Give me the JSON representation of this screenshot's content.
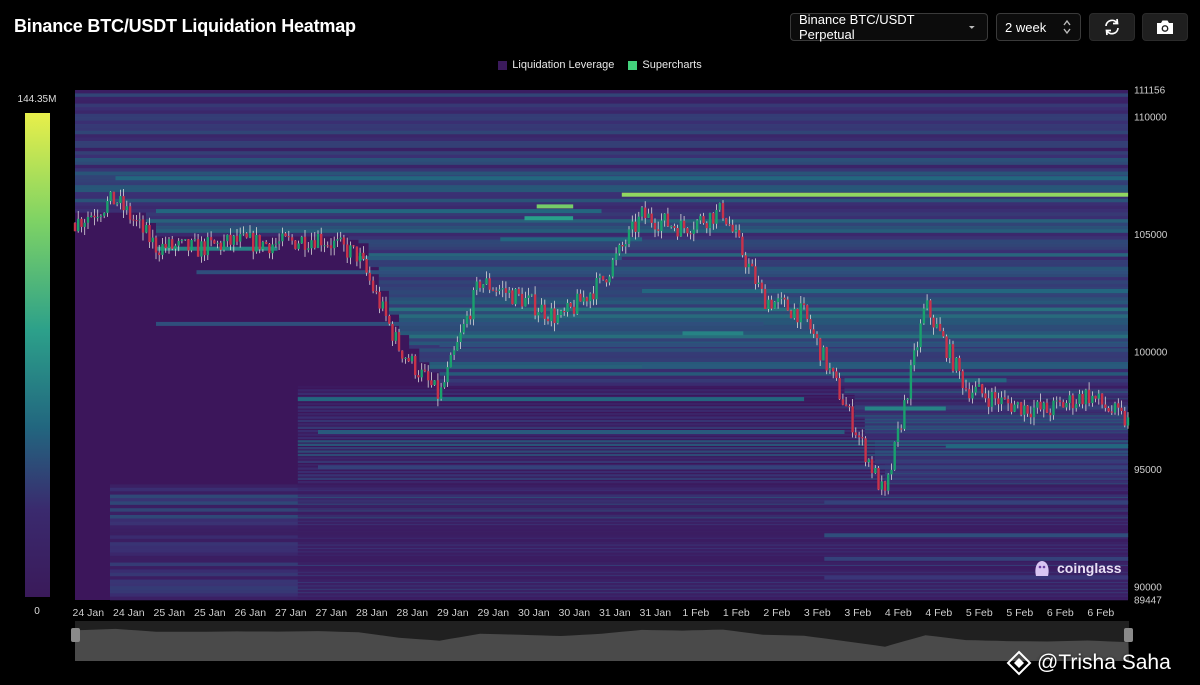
{
  "header": {
    "title": "Binance BTC/USDT Liquidation Heatmap",
    "pair_select": "Binance BTC/USDT Perpetual",
    "range_select": "2 week",
    "icons": [
      "refresh-icon",
      "camera-icon",
      "chevron-down-icon",
      "stepper-icon"
    ]
  },
  "legend": [
    {
      "label": "Liquidation Leverage",
      "color": "#3b1a5c"
    },
    {
      "label": "Supercharts",
      "color": "#43d17c"
    }
  ],
  "colorbar": {
    "max_label": "144.35M",
    "min_label": "0",
    "colors": [
      "#e8ef4a",
      "#7fd364",
      "#2ca08a",
      "#22667f",
      "#3a2a6e",
      "#3a1a5a"
    ]
  },
  "brand": {
    "name": "coinglass",
    "color": "#d9c4f2"
  },
  "watermark": {
    "text": "@Trisha Saha"
  },
  "chart_data": {
    "type": "heatmap",
    "title": "Binance BTC/USDT Liquidation Heatmap",
    "x_tick_labels": [
      "24 Jan",
      "24 Jan",
      "25 Jan",
      "25 Jan",
      "26 Jan",
      "27 Jan",
      "27 Jan",
      "28 Jan",
      "28 Jan",
      "29 Jan",
      "29 Jan",
      "30 Jan",
      "30 Jan",
      "31 Jan",
      "31 Jan",
      "1 Feb",
      "1 Feb",
      "2 Feb",
      "3 Feb",
      "3 Feb",
      "4 Feb",
      "4 Feb",
      "5 Feb",
      "5 Feb",
      "6 Feb",
      "6 Feb"
    ],
    "y_ticks": [
      111156,
      110000,
      105000,
      100000,
      95000,
      90000,
      89447
    ],
    "ylim": [
      89447,
      111156
    ],
    "colorbar_range": [
      0,
      144350000
    ],
    "price_series": {
      "name": "BTC/USDT",
      "x": [
        0,
        1,
        2,
        3,
        4,
        5,
        6,
        7,
        8,
        9,
        10,
        11,
        12,
        13,
        14,
        15,
        16,
        17,
        18,
        19,
        20,
        21,
        22,
        23,
        24,
        25,
        26
      ],
      "values": [
        105500,
        106500,
        104500,
        104400,
        104700,
        104600,
        104900,
        104100,
        100200,
        98100,
        103000,
        102300,
        101400,
        103000,
        105800,
        105300,
        106000,
        102300,
        101600,
        97800,
        93800,
        102000,
        98500,
        97800,
        97500,
        98200,
        97000
      ]
    },
    "liquidation_bands": [
      {
        "price": 106700,
        "intensity": 0.85,
        "from": 13.5,
        "to": 26
      },
      {
        "price": 106200,
        "intensity": 0.8,
        "from": 11.4,
        "to": 12.3
      },
      {
        "price": 105700,
        "intensity": 0.65,
        "from": 11.1,
        "to": 12.3
      },
      {
        "price": 107400,
        "intensity": 0.45,
        "from": 1,
        "to": 26
      },
      {
        "price": 106000,
        "intensity": 0.45,
        "from": 2,
        "to": 13
      },
      {
        "price": 104400,
        "intensity": 0.55,
        "from": 2,
        "to": 5
      },
      {
        "price": 104800,
        "intensity": 0.45,
        "from": 10.5,
        "to": 14
      },
      {
        "price": 104000,
        "intensity": 0.4,
        "from": 7,
        "to": 13.5
      },
      {
        "price": 103400,
        "intensity": 0.35,
        "from": 3,
        "to": 26
      },
      {
        "price": 102600,
        "intensity": 0.45,
        "from": 14,
        "to": 26
      },
      {
        "price": 101200,
        "intensity": 0.35,
        "from": 2,
        "to": 17
      },
      {
        "price": 100800,
        "intensity": 0.55,
        "from": 15,
        "to": 16.5
      },
      {
        "price": 100300,
        "intensity": 0.35,
        "from": 9,
        "to": 26
      },
      {
        "price": 99400,
        "intensity": 0.4,
        "from": 14,
        "to": 26
      },
      {
        "price": 98800,
        "intensity": 0.45,
        "from": 19,
        "to": 23
      },
      {
        "price": 98000,
        "intensity": 0.45,
        "from": 5.5,
        "to": 18
      },
      {
        "price": 97600,
        "intensity": 0.55,
        "from": 19.5,
        "to": 21.5
      },
      {
        "price": 96600,
        "intensity": 0.4,
        "from": 6,
        "to": 19
      },
      {
        "price": 96000,
        "intensity": 0.45,
        "from": 21.5,
        "to": 26
      },
      {
        "price": 95100,
        "intensity": 0.3,
        "from": 6,
        "to": 26
      },
      {
        "price": 93600,
        "intensity": 0.3,
        "from": 18.5,
        "to": 26
      },
      {
        "price": 92200,
        "intensity": 0.35,
        "from": 18.5,
        "to": 26
      },
      {
        "price": 91200,
        "intensity": 0.3,
        "from": 18.5,
        "to": 26
      },
      {
        "price": 90400,
        "intensity": 0.25,
        "from": 18.5,
        "to": 26
      }
    ]
  }
}
